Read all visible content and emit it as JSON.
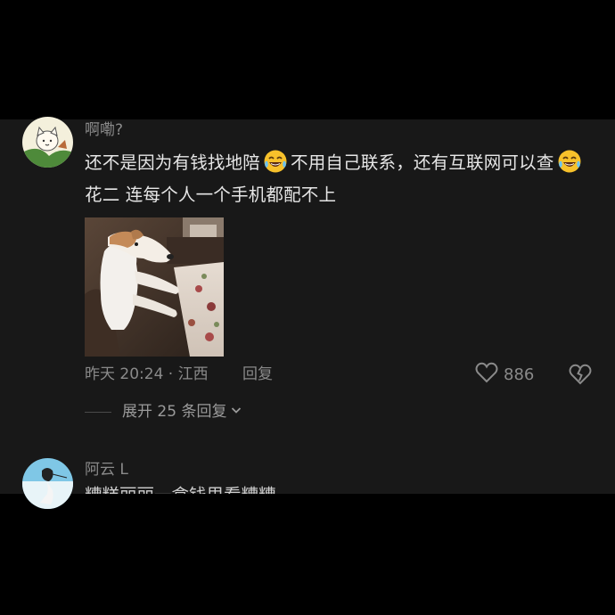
{
  "comment": {
    "username": "啊嘞?",
    "text_part1": "还不是因为有钱找地陪",
    "text_part2": "不用自己联系，还有互联网可以查",
    "text_part3": "花二 连每个人一个手机都配不上",
    "emoji_1": "laughing-tears-emoji",
    "emoji_2": "laughing-tears-emoji",
    "time_location": "昨天 20:24 · 江西",
    "reply_label": "回复",
    "like_count": "886",
    "expand_replies": "展开 25 条回复"
  },
  "next_comment": {
    "username": "阿云 L",
    "text_partial": "糟糕丽丽一盒钱里看糟糟"
  },
  "colors": {
    "background": "#000000",
    "panel": "#181818",
    "text_primary": "#e6e6e6",
    "text_secondary": "#8a8a8a"
  }
}
